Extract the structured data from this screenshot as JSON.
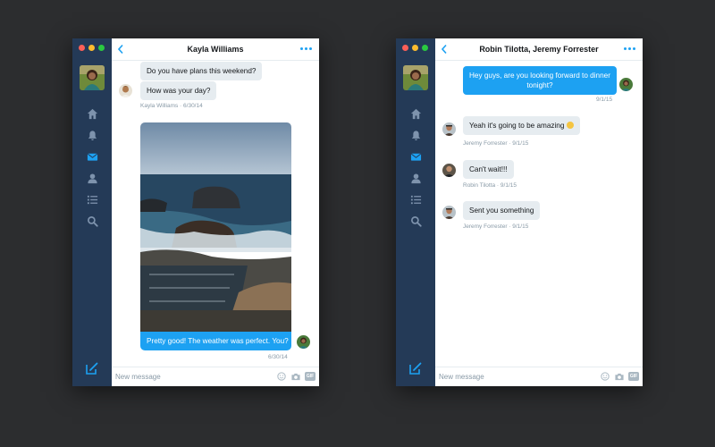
{
  "windows": [
    {
      "title": "Kayla Williams",
      "messages": [
        {
          "text": "Do you have plans this weekend?"
        },
        {
          "text": "How was your day?"
        },
        {
          "text": "Pretty good! The weather was perfect. You?"
        }
      ],
      "meta": [
        "Kayla Williams · 6/30/14",
        "6/30/14"
      ],
      "input_placeholder": "New message"
    },
    {
      "title": "Robin Tilotta, Jeremy Forrester",
      "messages": [
        {
          "text": "Hey guys, are you looking forward to dinner",
          "text2": "tonight?"
        },
        {
          "text": "Yeah it's going to be amazing"
        },
        {
          "text": "Can't wait!!!"
        },
        {
          "text": "Sent you something"
        }
      ],
      "meta": [
        "9/1/15",
        "Jeremy Forrester · 9/1/15",
        "Robin Tilotta · 9/1/15",
        "Jeremy Forrester · 9/1/15"
      ],
      "input_placeholder": "New message"
    }
  ],
  "gif_label": "GIF",
  "icons": [
    "home-icon",
    "notifications-icon",
    "messages-icon",
    "profile-icon",
    "lists-icon",
    "search-icon",
    "compose-icon",
    "back-icon",
    "more-icon",
    "emoji-icon",
    "camera-icon",
    "gif-icon"
  ],
  "colors": {
    "sidebar": "#243a57",
    "accent": "#1da1f2",
    "bubble_in": "#e6ecf0",
    "background": "#2c2d2f"
  }
}
